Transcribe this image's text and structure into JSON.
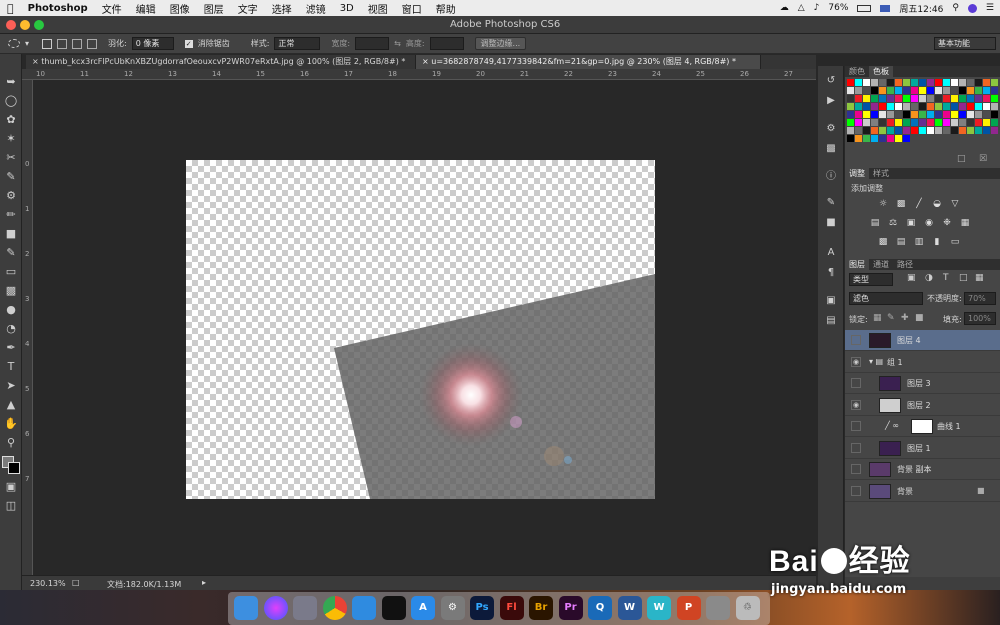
{
  "menubar": {
    "apple": "",
    "app": "Photoshop",
    "items": [
      "文件",
      "编辑",
      "图像",
      "图层",
      "文字",
      "选择",
      "滤镜",
      "3D",
      "视图",
      "窗口",
      "帮助"
    ],
    "battery": "76%",
    "clock": "周五12:46"
  },
  "titlebar": {
    "title": "Adobe Photoshop CS6"
  },
  "options": {
    "feather_label": "羽化:",
    "feather_value": "0 像素",
    "antialias_label": "消除锯齿",
    "style_label": "样式:",
    "style_value": "正常",
    "width_label": "宽度:",
    "height_label": "高度:",
    "refine_button": "调整边缘...",
    "workspace": "基本功能"
  },
  "tabs": [
    {
      "label": "thumb_kcx3rcFlPcUbKnXBZUgdorrafOeouxcvP2WR07eRxtA.jpg @ 100% (图层 2, RGB/8#) *",
      "active": false
    },
    {
      "label": "u=3682878749,4177339842&fm=21&gp=0.jpg @ 230% (图层 4, RGB/8#) *",
      "active": true
    }
  ],
  "ruler": {
    "top_labels": [
      "10",
      "11",
      "12",
      "13",
      "14",
      "15",
      "16",
      "17",
      "18",
      "19",
      "20",
      "21",
      "22",
      "23",
      "24",
      "25",
      "26",
      "27"
    ],
    "left_labels": [
      "0",
      "1",
      "2",
      "3",
      "4",
      "5",
      "6",
      "7"
    ]
  },
  "status": {
    "zoom": "230.13%",
    "doc": "文档:182.0K/1.13M"
  },
  "panels": {
    "color_tab": "颜色",
    "swatches_tab": "色板",
    "adjust_tab": "调整",
    "styles_tab": "样式",
    "add_adjustment": "添加调整",
    "layers_tab": "图层",
    "channels_tab": "通道",
    "paths_tab": "路径",
    "kind_filter": "类型",
    "blend_mode": "滤色",
    "opacity_label": "不透明度:",
    "opacity_value": "70%",
    "lock_label": "锁定:",
    "fill_label": "填充:",
    "fill_value": "100%"
  },
  "layers": [
    {
      "name": "图层 4",
      "selected": true,
      "visible": false
    },
    {
      "name": "组 1",
      "selected": false,
      "visible": true
    },
    {
      "name": "图层 3",
      "selected": false,
      "visible": false
    },
    {
      "name": "图层 2",
      "selected": false,
      "visible": true
    },
    {
      "name": "曲线 1",
      "selected": false,
      "visible": false
    },
    {
      "name": "图层 1",
      "selected": false,
      "visible": false
    },
    {
      "name": "背景 副本",
      "selected": false,
      "visible": false
    },
    {
      "name": "背景",
      "selected": false,
      "visible": false
    }
  ],
  "dock": [
    "Finder",
    "Siri",
    "Launchpad",
    "Chrome",
    "Safari",
    "QQ",
    "App Store",
    "System Preferences",
    "Ps",
    "Fl",
    "Br",
    "Pr",
    "QuickTime",
    "Word",
    "W",
    "PowerPoint",
    "Preview",
    "Trash"
  ],
  "watermark": {
    "brand": "Bai du 经验",
    "url": "jingyan.baidu.com"
  },
  "colors": {
    "accent": "#5a6d8c",
    "bg": "#282828",
    "panel": "#464646"
  }
}
